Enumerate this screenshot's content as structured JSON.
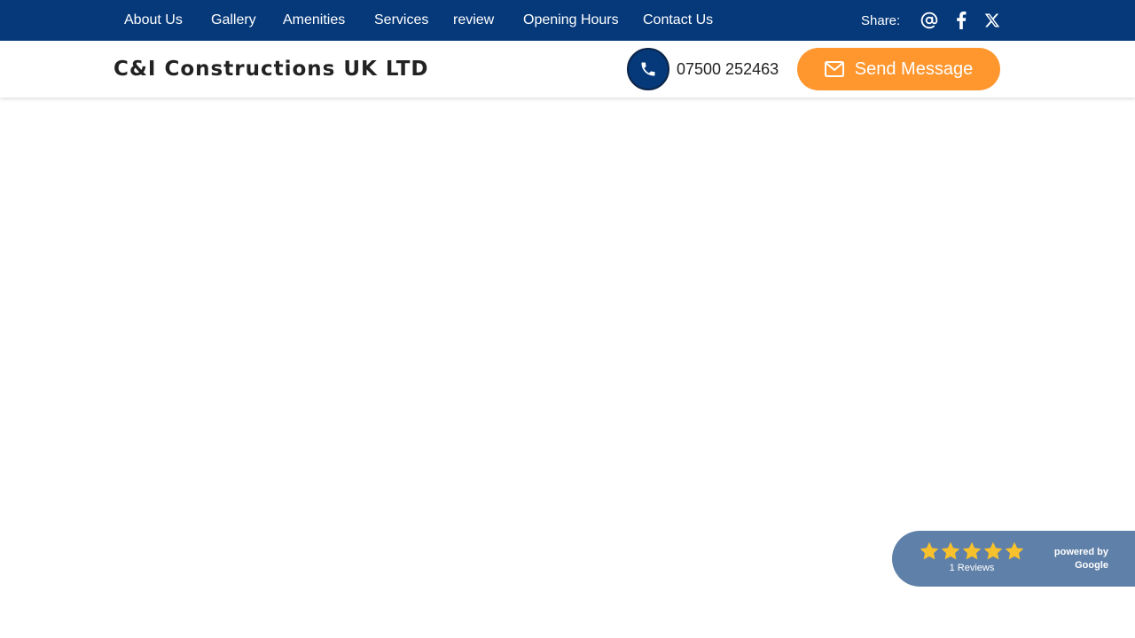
{
  "colors": {
    "nav_background": "#06397a",
    "accent_orange": "#ff962e",
    "star_yellow": "#f7c12d",
    "review_widget": "#5f80a8",
    "text_dark": "#222222"
  },
  "topnav": {
    "items": [
      {
        "label": "About Us"
      },
      {
        "label": "Gallery"
      },
      {
        "label": "Amenities"
      },
      {
        "label": "Services"
      },
      {
        "label": "review"
      },
      {
        "label": "Opening Hours"
      },
      {
        "label": "Contact Us"
      }
    ],
    "share_label": "Share:",
    "share_icons": [
      "email-at-icon",
      "facebook-icon",
      "x-twitter-icon"
    ]
  },
  "header": {
    "brand": "C&I Constructions UK LTD",
    "phone_icon": "phone-icon",
    "phone_number": "07500 252463",
    "send_icon": "envelope-icon",
    "send_label": "Send Message"
  },
  "reviews": {
    "rating": 5,
    "max_rating": 5,
    "count_label": "1 Reviews",
    "powered_line1": "powered by",
    "powered_line2": "Google"
  }
}
